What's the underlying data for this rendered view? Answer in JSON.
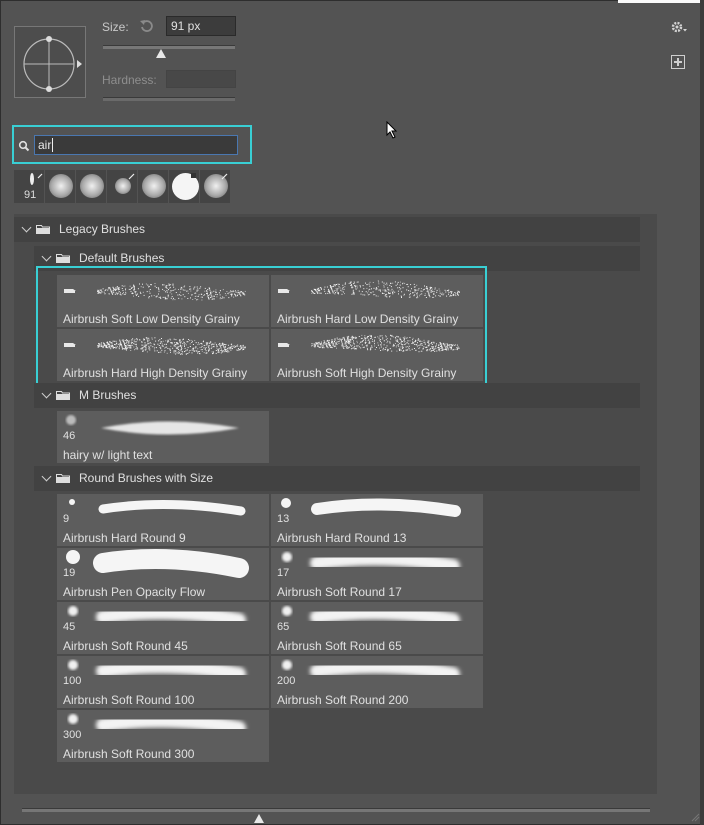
{
  "header": {
    "size_label": "Size:",
    "size_value": "91 px",
    "hardness_label": "Hardness:",
    "size_slider_fraction": 0.5
  },
  "search": {
    "value": "air"
  },
  "recent_brushes": [
    {
      "num": "91"
    }
  ],
  "groups": {
    "legacy": "Legacy Brushes",
    "default": "Default Brushes",
    "m": "M Brushes",
    "round": "Round Brushes with Size"
  },
  "default_brushes": [
    "Airbrush Soft Low Density Grainy",
    "Airbrush Hard Low Density Grainy",
    "Airbrush Hard High Density Grainy",
    "Airbrush Soft High Density Grainy"
  ],
  "m_brushes": [
    {
      "num": "46",
      "name": "hairy w/ light text"
    }
  ],
  "round_brushes": [
    {
      "num": "9",
      "name": "Airbrush Hard Round 9"
    },
    {
      "num": "13",
      "name": "Airbrush Hard Round 13"
    },
    {
      "num": "19",
      "name": "Airbrush Pen Opacity Flow"
    },
    {
      "num": "17",
      "name": "Airbrush Soft Round 17"
    },
    {
      "num": "45",
      "name": "Airbrush Soft Round 45"
    },
    {
      "num": "65",
      "name": "Airbrush Soft Round 65"
    },
    {
      "num": "100",
      "name": "Airbrush Soft Round 100"
    },
    {
      "num": "200",
      "name": "Airbrush Soft Round 200"
    },
    {
      "num": "300",
      "name": "Airbrush Soft Round 300"
    }
  ],
  "colors": {
    "highlight": "#39cfd4",
    "panel": "#535353"
  }
}
